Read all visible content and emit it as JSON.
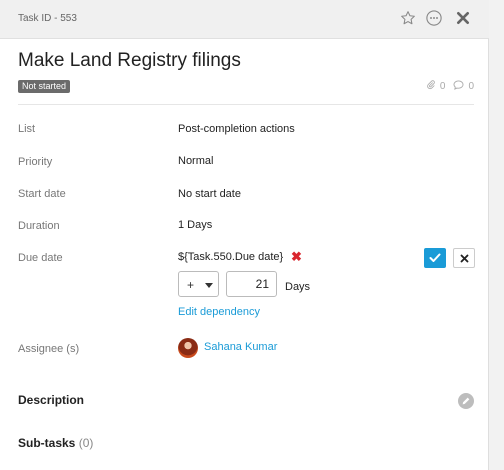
{
  "header": {
    "task_id": "Task ID - 553",
    "icons": [
      "star-icon",
      "more-icon",
      "close-icon"
    ]
  },
  "task": {
    "title": "Make Land Registry filings",
    "status": "Not started",
    "attachments_count": "0",
    "comments_count": "0"
  },
  "fields": {
    "list_label": "List",
    "list_value": "Post-completion actions",
    "priority_label": "Priority",
    "priority_value": "Normal",
    "start_label": "Start date",
    "start_value": "No start date",
    "duration_label": "Duration",
    "duration_value": "1 Days",
    "due_label": "Due date",
    "due_value": "${Task.550.Due date}",
    "offset_sign": "+",
    "offset_value": "21",
    "offset_unit": "Days",
    "edit_dependency": "Edit dependency",
    "assignee_label": "Assignee (s)",
    "assignee_name": "Sahana Kumar"
  },
  "sections": {
    "description": "Description",
    "subtasks": "Sub-tasks",
    "subtasks_count": "(0)"
  },
  "colors": {
    "accent": "#1a9bd7",
    "danger": "#d9262e",
    "badge": "#6b6b6b"
  }
}
